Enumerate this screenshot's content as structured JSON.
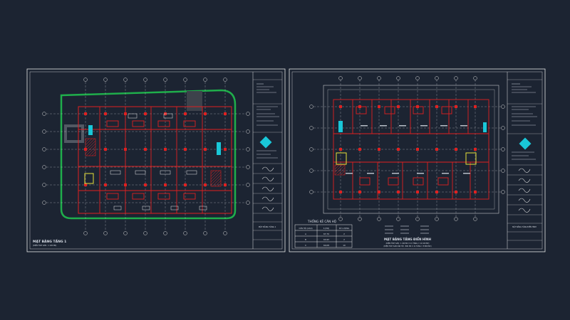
{
  "colors": {
    "background": "#1c2432",
    "frame": "#e6e6e6",
    "wall": "#e02020",
    "grid_axis": "#d8d8d8",
    "cyan": "#19c7d8",
    "green": "#1fae4b",
    "yellow": "#e8e23a",
    "gray": "#6a6f78"
  },
  "sheet_left": {
    "title": "MẶT BẰNG TẦNG 1",
    "subtitle": "(DIỆN TÍCH SÀN : 1 100 M2)",
    "title_block_caption": "MẶT BẰNG TẦNG 1"
  },
  "sheet_right": {
    "title": "MẶT BẰNG TẦNG ĐIỂN HÌNH",
    "subtitle1": "(DIỆN TÍCH SÀN : 1 100 M2 X 11 TẦNG = 12 100 M2)",
    "subtitle2": "(DIỆN TÍCH SÀN CĂN HỘ : 800 M2 X 11 TẦNG = 8 800 M2)",
    "title_block_caption": "MẶT BẰNG TẦNG ĐIỂN HÌNH"
  },
  "stats_table": {
    "title": "THỐNG KÊ CĂN HỘ",
    "headers": [
      "CĂN HỘ (LOẠI)",
      "S (M2)",
      "SỐ LƯỢNG"
    ],
    "rows": [
      [
        "A",
        "67,70",
        "2"
      ],
      [
        "B",
        "63,95",
        "2"
      ],
      [
        "C",
        "60,08",
        "10"
      ]
    ]
  }
}
